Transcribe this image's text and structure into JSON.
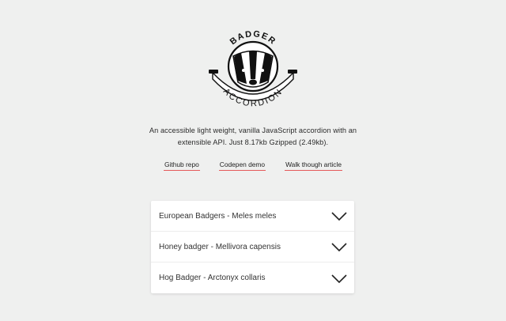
{
  "logo": {
    "top_text": "BADGER",
    "bottom_text": "ACCORDION"
  },
  "intro": "An accessible light weight, vanilla JavaScript accordion with an extensible API. Just 8.17kb Gzipped (2.49kb).",
  "links": [
    {
      "label": "Github repo"
    },
    {
      "label": "Codepen demo"
    },
    {
      "label": "Walk though article"
    }
  ],
  "accordion": [
    {
      "label": "European Badgers - Meles meles"
    },
    {
      "label": "Honey badger - Mellivora capensis"
    },
    {
      "label": "Hog Badger - Arctonyx collaris"
    }
  ],
  "colors": {
    "background": "#eff0ef",
    "link_underline": "#e45a5a",
    "panel": "#ffffff"
  },
  "icons": [
    "badger-logo-icon",
    "chevron-down-icon"
  ]
}
